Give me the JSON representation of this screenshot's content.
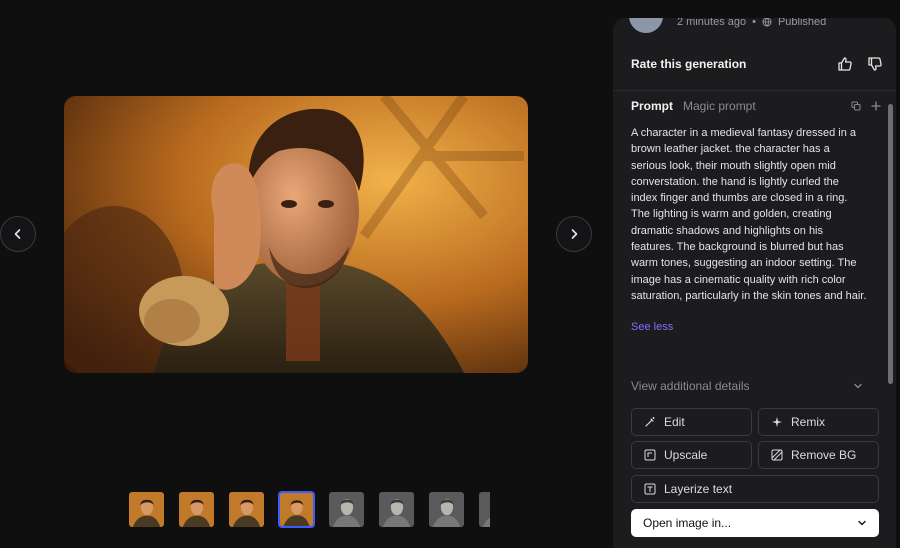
{
  "meta": {
    "time": "2 minutes ago",
    "separator": "•",
    "visibility": "Published"
  },
  "rate": {
    "title": "Rate this generation"
  },
  "tabs": [
    {
      "label": "Prompt"
    },
    {
      "label": "Magic prompt"
    }
  ],
  "prompt": {
    "text": "A character in a medieval fantasy dressed in a brown leather jacket. the character has a serious look, their mouth slightly open mid converstation. the hand is lightly curled the index finger and thumbs are closed in a ring. The lighting is warm and golden, creating dramatic shadows and highlights on his features. The background is blurred but has warm tones, suggesting an indoor setting. The image has a cinematic quality with rich color saturation, particularly in the skin tones and hair.",
    "see_less": "See less"
  },
  "details": {
    "label": "View additional details"
  },
  "actions": {
    "edit": "Edit",
    "remix": "Remix",
    "upscale": "Upscale",
    "remove_bg": "Remove BG",
    "layerize": "Layerize text",
    "open_in": "Open image in..."
  },
  "thumbnails": [
    {
      "style": "warm",
      "active": false
    },
    {
      "style": "warm",
      "active": false
    },
    {
      "style": "warm",
      "active": false
    },
    {
      "style": "warm",
      "active": true
    },
    {
      "style": "gray",
      "active": false
    },
    {
      "style": "gray",
      "active": false
    },
    {
      "style": "gray",
      "active": false
    },
    {
      "style": "gray",
      "active": false
    }
  ],
  "colors": {
    "accent": "#8b6cff",
    "panel": "#1c1c1e",
    "background": "#0f0f10",
    "selected_border": "#3b5bff"
  }
}
